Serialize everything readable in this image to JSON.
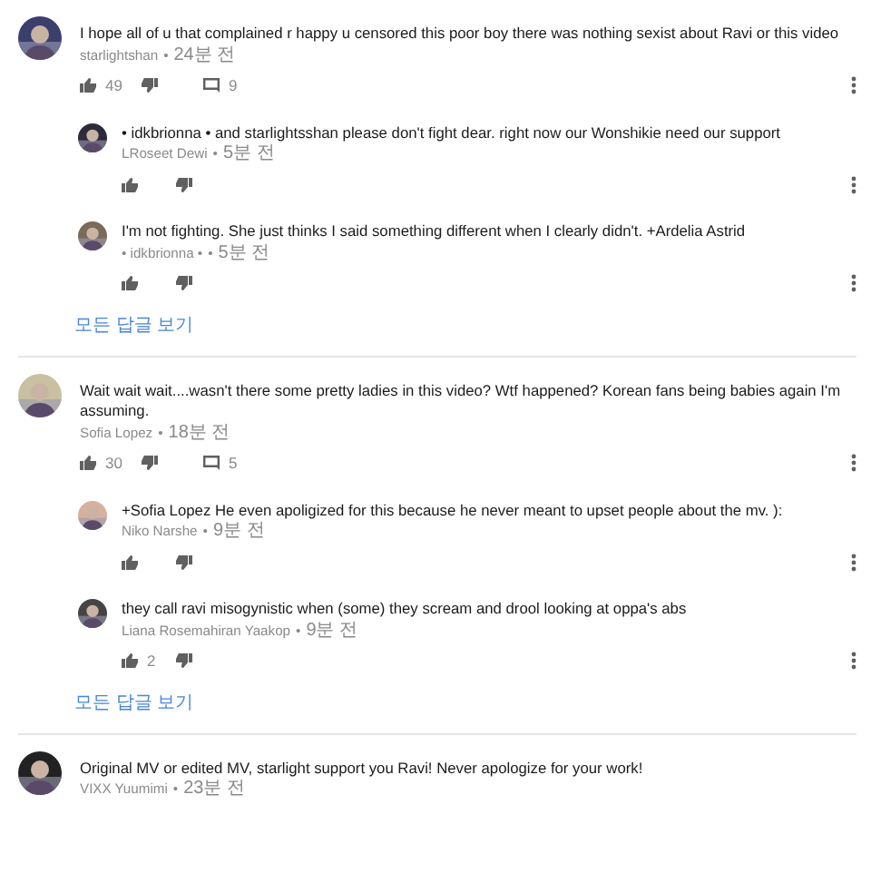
{
  "threads": [
    {
      "avatar": {
        "kind": "picture"
      },
      "text": "I hope all of u that complained r happy u censored this poor boy there was nothing sexist about Ravi or this video",
      "author": "starlightshan",
      "separator": "•",
      "time": "24분 전",
      "likes": "49",
      "reply_count": "9",
      "replies": [
        {
          "avatar": {
            "kind": "picture"
          },
          "text": "• idkbrionna •  and starlightsshan please don't fight dear. right now our Wonshikie need our support",
          "author": "LRoseet Dewi",
          "separator": "•",
          "time": "5분 전"
        },
        {
          "avatar": {
            "kind": "picture"
          },
          "text": "I'm not fighting. She just thinks I said something different when I clearly didn't. +Ardelia Astrid",
          "author": "• idkbrionna •",
          "separator": "•",
          "time": "5분 전"
        }
      ],
      "view_all": "모든 답글 보기"
    },
    {
      "avatar": {
        "kind": "picture"
      },
      "text": "Wait wait wait....wasn't there some pretty ladies in this video? Wtf happened? Korean fans being babies again I'm assuming.",
      "author": "Sofia Lopez",
      "separator": "•",
      "time": "18분 전",
      "likes": "30",
      "reply_count": "5",
      "replies": [
        {
          "avatar": {
            "kind": "picture"
          },
          "text": "+Sofia Lopez He even apoligized for this because he never meant to upset people about the mv. ):",
          "author": "Niko Narshe",
          "separator": "•",
          "time": "9분 전"
        },
        {
          "avatar": {
            "kind": "picture"
          },
          "text": "they call ravi misogynistic when (some) they scream and drool looking at oppa's abs",
          "author": "Liana Rosemahiran Yaakop",
          "separator": "•",
          "time": "9분 전",
          "likes": "2"
        }
      ],
      "view_all": "모든 답글 보기"
    },
    {
      "avatar": {
        "kind": "picture"
      },
      "text": "Original MV or edited MV, starlight support you Ravi! Never apologize for your work!",
      "author": "VIXX Yuumimi",
      "separator": "•",
      "time": "23분 전"
    }
  ]
}
